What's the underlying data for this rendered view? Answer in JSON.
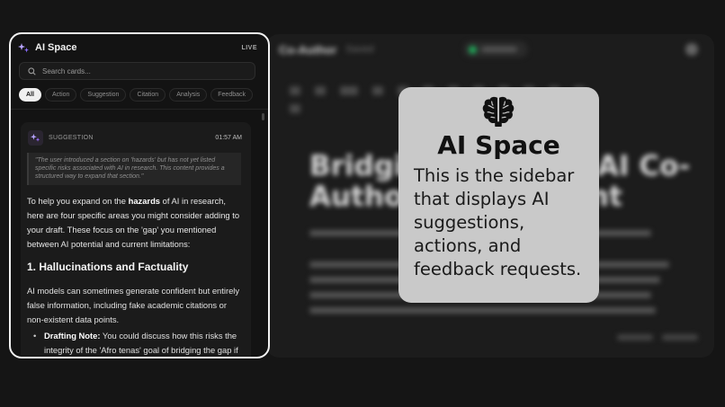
{
  "sidebar": {
    "title": "AI Space",
    "live_label": "LIVE",
    "search_placeholder": "Search cards...",
    "filters": [
      "All",
      "Action",
      "Suggestion",
      "Citation",
      "Analysis",
      "Feedback"
    ],
    "active_filter": "All"
  },
  "card": {
    "type_label": "SUGGESTION",
    "time": "01:57 AM",
    "quote": "\"The user introduced a section on 'hazards' but has not yet listed specific risks associated with AI in research. This content provides a structured way to expand that section.\"",
    "intro_pre": "To help you expand on the ",
    "intro_bold": "hazards",
    "intro_post": " of AI in research, here are four specific areas you might consider adding to your draft. These focus on the 'gap' you mentioned between AI potential and current limitations:",
    "heading": "1. Hallucinations and Factuality",
    "paragraph": "AI models can sometimes generate confident but entirely false information, including fake academic citations or non-existent data points.",
    "bullet_bold": "Drafting Note:",
    "bullet_text": " You could discuss how this risks the integrity of the 'Afro tenas' goal of bridging the gap if"
  },
  "tooltip": {
    "icon": "brain-icon",
    "title": "AI Space",
    "text": "This is the sidebar that displays AI suggestions, actions, and feedback requests."
  },
  "editor": {
    "title": "Co-Author",
    "subtitle": "Saved",
    "heading": "Bridging the Gap: AI Co-Authoring Assistant"
  },
  "colors": {
    "accent_purple": "#9b6bff",
    "live_green": "#1faa59",
    "tooltip_bg": "#c9c9c9"
  }
}
